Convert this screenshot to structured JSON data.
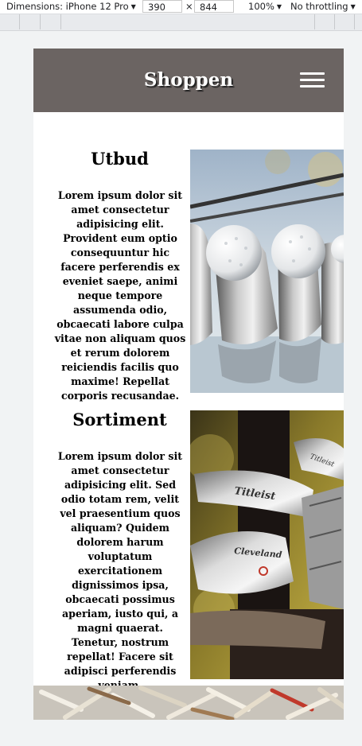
{
  "devtools": {
    "dimensions_label": "Dimensions: iPhone 12 Pro",
    "width": "390",
    "times": "×",
    "height": "844",
    "zoom": "100%",
    "throttling": "No throttling"
  },
  "site": {
    "brand": "Shoppen",
    "menu_icon": "hamburger-menu-icon"
  },
  "sections": [
    {
      "title": "Utbud",
      "body": "Lorem ipsum dolor sit amet consectetur adipisicing elit. Provident eum optio consequuntur hic facere perferendis ex eveniet saepe, animi neque tempore assumenda odio, obcaecati labore culpa vitae non aliquam quos et rerum dolorem reiciendis facilis quo maxime! Repellat corporis recusandae."
    },
    {
      "title": "Sortiment",
      "body": "Lorem ipsum dolor sit amet consectetur adipisicing elit. Sed odio totam rem, velit vel praesentium quos aliquam? Quidem dolorem harum voluptatum exercitationem dignissimos ipsa, obcaecati possimus aperiam, iusto qui, a magni quaerat. Tenetur, nostrum repellat! Facere sit adipisci perferendis veniam."
    }
  ],
  "club_brands": {
    "titleist": "Titleist",
    "cleveland": "Cleveland"
  }
}
